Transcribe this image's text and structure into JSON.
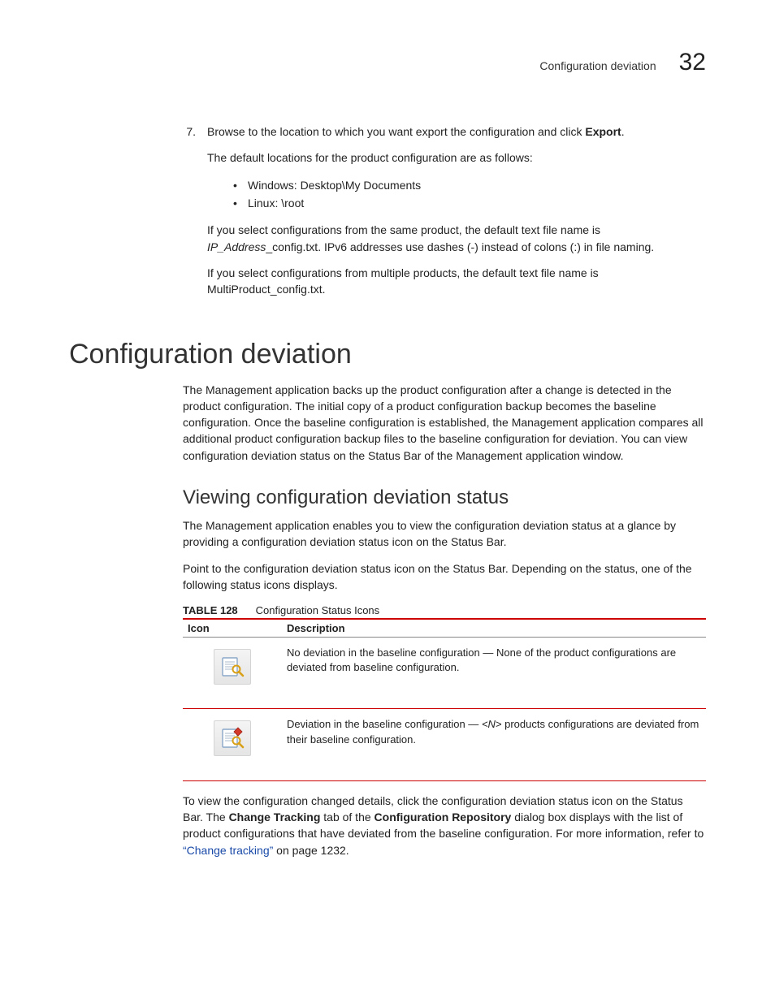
{
  "header": {
    "running_title": "Configuration deviation",
    "chapter_number": "32"
  },
  "step7": {
    "number": "7.",
    "line1_a": "Browse to the location to which you want export the configuration and click ",
    "line1_bold": "Export",
    "line1_b": ".",
    "line2": "The default locations for the product configuration are as follows:",
    "bullet1": "Windows: Desktop\\My Documents",
    "bullet2": "Linux: \\root",
    "line3_a": "If you select configurations from the same product, the default text file name is ",
    "line3_italic": "IP_Address",
    "line3_b": "_config.txt. IPv6 addresses use dashes (-) instead of colons (:) in file naming.",
    "line4": "If you select configurations from multiple products, the default text file name is MultiProduct_config.txt."
  },
  "section": {
    "title": "Configuration deviation",
    "intro": "The Management application backs up the product configuration after a change is detected in the product configuration. The initial copy of a product configuration backup becomes the baseline configuration. Once the baseline configuration is established, the Management application compares all additional product configuration backup files to the baseline configuration for deviation. You can view configuration deviation status on the Status Bar of the Management application window."
  },
  "subsection": {
    "title": "Viewing configuration deviation status",
    "p1": "The Management application enables you to view the configuration deviation status at a glance by providing a configuration deviation status icon on the Status Bar.",
    "p2": "Point to the configuration deviation status icon on the Status Bar. Depending on the status, one of the following status icons displays."
  },
  "table": {
    "label": "TABLE 128",
    "caption": "Configuration Status Icons",
    "col1": "Icon",
    "col2": "Description",
    "row1_desc": "No deviation in the baseline configuration — None of the product configurations are deviated from baseline configuration.",
    "row2_a": "Deviation in the baseline configuration — ",
    "row2_italic": "<N>",
    "row2_b": " products configurations are deviated from their baseline configuration."
  },
  "after_table": {
    "a": "To view the configuration changed details, click the configuration deviation status icon on the Status Bar. The ",
    "b_bold": "Change Tracking",
    "c": " tab of the ",
    "d_bold": "Configuration Repository",
    "e": " dialog box displays with the list of product configurations that have deviated from the baseline configuration. For more information, refer to ",
    "link": "“Change tracking”",
    "f": " on page 1232."
  }
}
